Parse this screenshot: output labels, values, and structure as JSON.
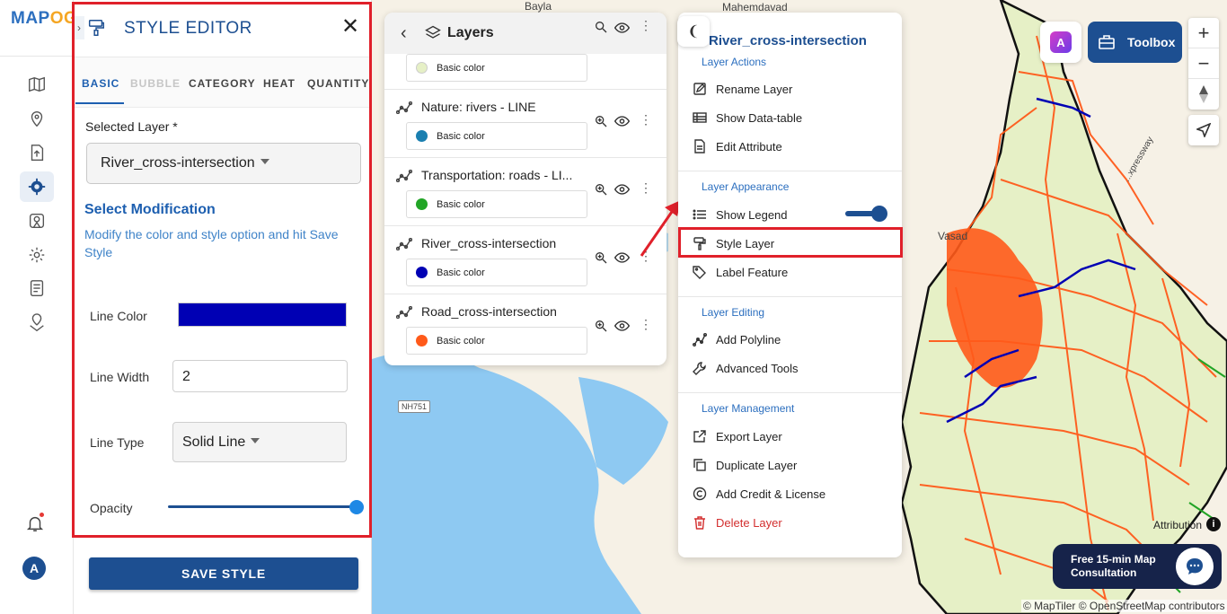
{
  "app": {
    "logo_main": "MAP",
    "logo_accent": "OG"
  },
  "rail": {
    "icons": [
      "map-icon",
      "location-pin-icon",
      "upload-icon",
      "settings-gear-icon",
      "analysis-icon",
      "cog-icon",
      "form-icon",
      "geo-location-icon"
    ],
    "active_index": 3,
    "notification_icon": "bell-icon",
    "avatar_initial": "A"
  },
  "style_editor": {
    "title": "STYLE EDITOR",
    "close_icon": "close-icon",
    "tabs": [
      "BASIC",
      "BUBBLE",
      "CATEGORY",
      "HEAT",
      "QUANTITY"
    ],
    "active_tab": "BASIC",
    "disabled_tab": "BUBBLE",
    "selected_layer_label": "Selected Layer *",
    "selected_layer_value": "River_cross-intersection",
    "select_modification_title": "Select Modification",
    "select_modification_desc": "Modify the color and style option and hit Save Style",
    "line_color_label": "Line Color",
    "line_color_value": "#0000b4",
    "line_width_label": "Line Width",
    "line_width_value": "2",
    "line_type_label": "Line Type",
    "line_type_value": "Solid Line",
    "opacity_label": "Opacity",
    "opacity_value": 1.0,
    "save_label": "SAVE STYLE"
  },
  "layers_panel": {
    "title": "Layers",
    "items": [
      {
        "name": "",
        "color_label": "Basic color",
        "color": "#e6f0c6"
      },
      {
        "name": "Nature: rivers - LINE",
        "color_label": "Basic color",
        "color": "#1a7fb0"
      },
      {
        "name": "Transportation: roads - LI...",
        "color_label": "Basic color",
        "color": "#22a526"
      },
      {
        "name": "River_cross-intersection",
        "color_label": "Basic color",
        "color": "#0000b4"
      },
      {
        "name": "Road_cross-intersection",
        "color_label": "Basic color",
        "color": "#ff5a1a"
      }
    ]
  },
  "context_menu": {
    "title": "River_cross-intersection",
    "sections": {
      "actions": "Layer Actions",
      "appearance": "Layer Appearance",
      "editing": "Layer Editing",
      "management": "Layer Management"
    },
    "items": {
      "rename": "Rename Layer",
      "datatable": "Show Data-table",
      "edit_attr": "Edit Attribute",
      "legend": "Show Legend",
      "style": "Style Layer",
      "label": "Label Feature",
      "polyline": "Add Polyline",
      "advanced": "Advanced Tools",
      "export": "Export Layer",
      "duplicate": "Duplicate Layer",
      "credit": "Add Credit & License",
      "delete": "Delete Layer"
    },
    "legend_enabled": true
  },
  "map": {
    "labels": {
      "bayla": "Bayla",
      "mahemdavad": "Mahemdavad",
      "vasad": "Vasad",
      "nh751": "NH751",
      "expressway": "...xpressway"
    },
    "toolbox_label": "Toolbox",
    "ai_label": "A",
    "attribution_label": "Attribution",
    "consultation_text": "Free 15-min Map Consultation",
    "copyright": "© MapTiler © OpenStreetMap contributors",
    "colors": {
      "land": "#f6f1e6",
      "water": "#8ec9f2",
      "region": "#e6f0c6",
      "roads": "#ff5a1a",
      "rivers": "#0000b4"
    }
  }
}
